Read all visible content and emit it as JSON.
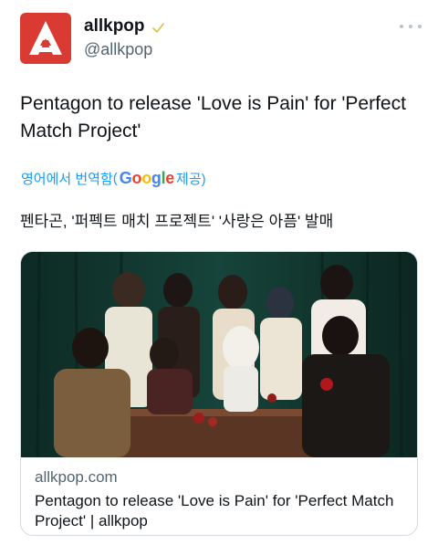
{
  "author": {
    "display_name": "allkpop",
    "handle": "@allkpop",
    "avatar_icon": "allkpop-logo-icon",
    "verified_icon": "verified-check-icon",
    "brand_color": "#d93a32"
  },
  "more_icon": "more-options-icon",
  "tweet": {
    "text": "Pentagon to release 'Love is Pain' for 'Perfect Match Project'",
    "translate_prefix": "영어에서 번역함",
    "translate_provider": "Google",
    "translate_suffix": "제공)",
    "translated_text": "펜타곤, '퍼펙트 매치 프로젝트' '사랑은 아픔' 발매"
  },
  "link_card": {
    "image_alt": "Pentagon group photo",
    "domain": "allkpop.com",
    "title": "Pentagon to release 'Love is Pain' for 'Perfect Match Project' | allkpop"
  },
  "colors": {
    "link_blue": "#1d9bf0",
    "secondary_text": "#536471",
    "google_blue": "#4285F4",
    "google_red": "#EA4335",
    "google_yellow": "#FBBC05",
    "google_green": "#34A853"
  }
}
